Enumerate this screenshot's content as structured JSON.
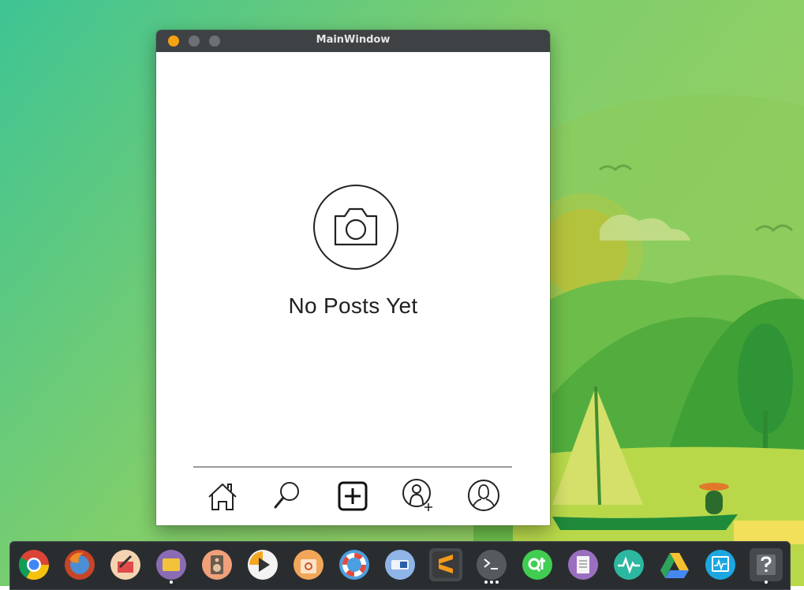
{
  "window": {
    "title": "MainWindow"
  },
  "feed": {
    "empty_message": "No Posts Yet"
  },
  "colors": {
    "titlebar": "#3e4244",
    "close_button": "#f6a312",
    "window_button": "#6d7173",
    "icon_stroke": "#222222",
    "dock": "#2a2d2f"
  },
  "bottom_nav": [
    {
      "name": "home",
      "icon": "home-icon"
    },
    {
      "name": "search",
      "icon": "search-icon"
    },
    {
      "name": "add-post",
      "icon": "add-box-icon"
    },
    {
      "name": "follow",
      "icon": "add-user-icon"
    },
    {
      "name": "profile",
      "icon": "profile-icon"
    }
  ],
  "dock": {
    "apps": [
      {
        "name": "chrome",
        "icon": "chrome-icon",
        "running": false
      },
      {
        "name": "firefox",
        "icon": "firefox-icon",
        "running": false
      },
      {
        "name": "editor",
        "icon": "pen-app-icon",
        "running": false
      },
      {
        "name": "files",
        "icon": "folder-icon",
        "running": true
      },
      {
        "name": "music",
        "icon": "speaker-icon",
        "running": false
      },
      {
        "name": "video-player",
        "icon": "play-icon",
        "running": false
      },
      {
        "name": "software-center",
        "icon": "shopping-bag-icon",
        "running": false
      },
      {
        "name": "help",
        "icon": "lifebuoy-icon",
        "running": false
      },
      {
        "name": "remote-desktop",
        "icon": "remote-desktop-icon",
        "running": false
      },
      {
        "name": "sublime-text",
        "icon": "sublime-icon",
        "running": false
      },
      {
        "name": "terminal",
        "icon": "terminal-icon",
        "running": true,
        "windows": 3
      },
      {
        "name": "qt-creator",
        "icon": "qt-icon",
        "running": false
      },
      {
        "name": "text-editor",
        "icon": "document-icon",
        "running": false
      },
      {
        "name": "system-monitor",
        "icon": "pulse-icon",
        "running": false
      },
      {
        "name": "google-drive",
        "icon": "drive-icon",
        "running": false
      },
      {
        "name": "system-monitor-2",
        "icon": "monitor-icon",
        "running": false
      },
      {
        "name": "unknown-app",
        "icon": "question-icon",
        "running": true
      }
    ]
  }
}
